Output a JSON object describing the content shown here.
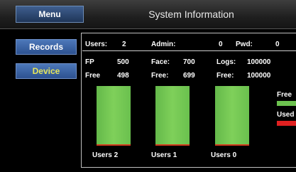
{
  "header": {
    "menu_label": "Menu",
    "title": "System Information"
  },
  "sidebar": {
    "records_label": "Records",
    "device_label": "Device"
  },
  "stats": {
    "row1": {
      "users_label": "Users:",
      "users_value": "2",
      "admin_label": "Admin:",
      "admin_value": "0",
      "pwd_label": "Pwd:",
      "pwd_value": "0"
    },
    "row2": {
      "fp_label": "FP",
      "fp_value": "500",
      "face_label": "Face:",
      "face_value": "700",
      "logs_label": "Logs:",
      "logs_value": "100000"
    },
    "row3": {
      "free_label1": "Free",
      "free_value1": "498",
      "free_label2": "Free:",
      "free_value2": "699",
      "free_label3": "Free:",
      "free_value3": "100000"
    }
  },
  "chart_data": {
    "type": "bar",
    "categories": [
      "Users 2",
      "Users 1",
      "Users 0"
    ],
    "series": [
      {
        "name": "Free",
        "values": [
          498,
          699,
          100000
        ]
      },
      {
        "name": "Used",
        "values": [
          2,
          1,
          0
        ]
      }
    ],
    "capacity": [
      500,
      700,
      100000
    ],
    "legend": [
      "Free",
      "Used"
    ],
    "colors": {
      "free": "#6cc24f",
      "used": "#e02020"
    }
  }
}
